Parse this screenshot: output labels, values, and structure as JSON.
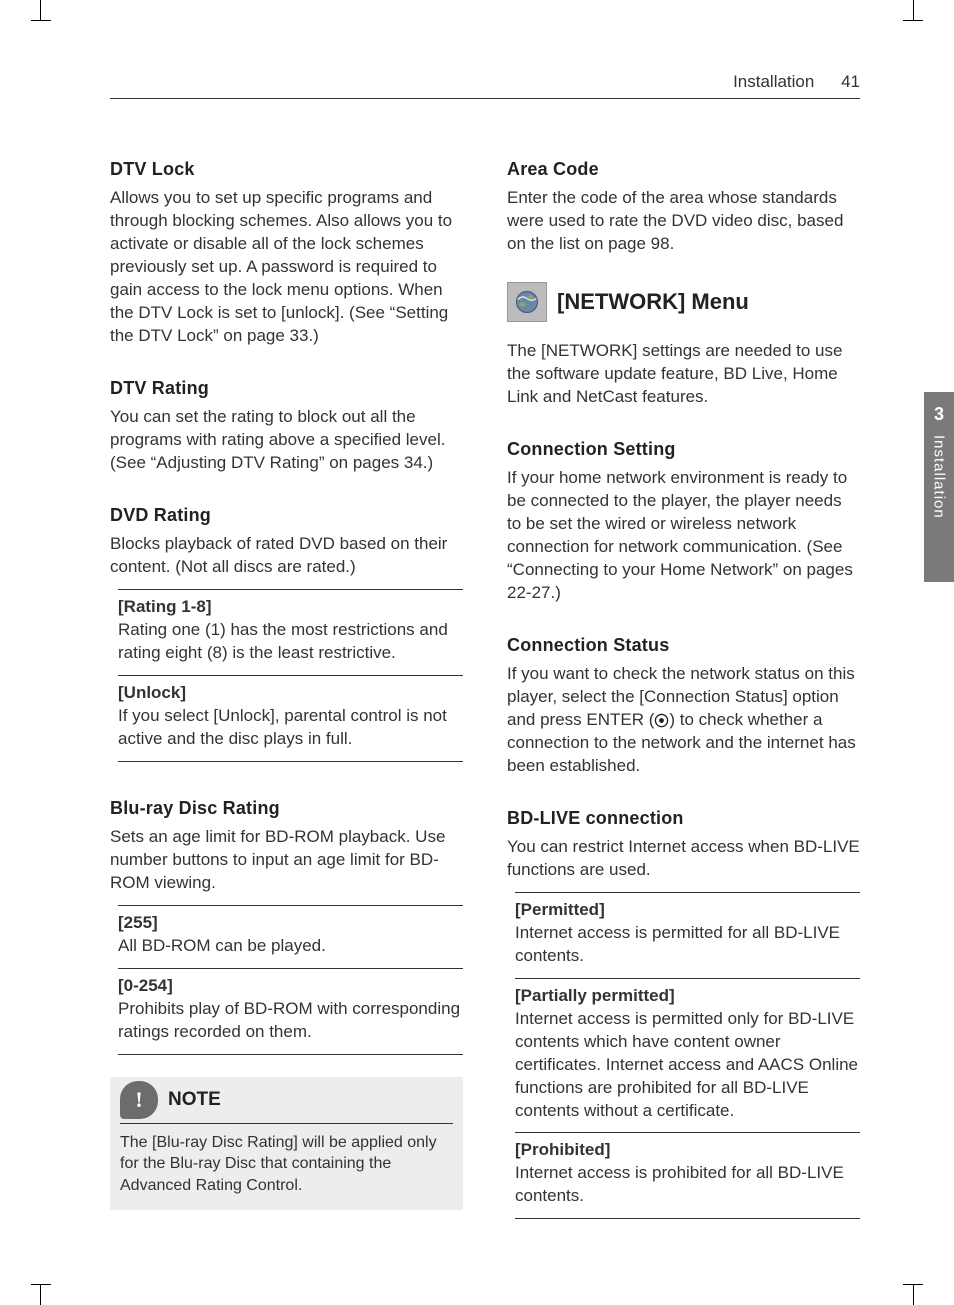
{
  "header": {
    "section": "Installation",
    "page": "41"
  },
  "sideTab": {
    "chapter": "3",
    "label": "Installation"
  },
  "left": {
    "dtvLock": {
      "title": "DTV Lock",
      "body": "Allows you to set up specific programs and through blocking schemes. Also allows you to activate or disable all of the lock schemes previously set up. A password is required to gain access to the lock menu options. When the DTV Lock is set to [unlock]. (See “Setting the DTV Lock” on page 33.)"
    },
    "dtvRating": {
      "title": "DTV Rating",
      "body": "You can set the rating to block out all the programs with rating above a specified level. (See “Adjusting DTV Rating” on pages 34.)"
    },
    "dvdRating": {
      "title": "DVD Rating",
      "body": "Blocks playback of rated DVD based on their content. (Not all discs are rated.)",
      "defs": [
        {
          "dt": "[Rating 1-8]",
          "dd": "Rating one (1) has the most restrictions and rating eight (8) is the least restrictive."
        },
        {
          "dt": "[Unlock]",
          "dd": "If you select [Unlock], parental control is not active and the disc plays in full."
        }
      ]
    },
    "bdRating": {
      "title": "Blu-ray Disc Rating",
      "body": "Sets an age limit for BD-ROM playback. Use number buttons to input an age limit for BD-ROM viewing.",
      "defs": [
        {
          "dt": "[255]",
          "dd": "All BD-ROM can be played."
        },
        {
          "dt": "[0-254]",
          "dd": "Prohibits play of BD-ROM with corresponding ratings recorded on them."
        }
      ]
    },
    "note": {
      "label": "NOTE",
      "body": "The [Blu-ray Disc Rating] will be applied only for the Blu-ray Disc that containing the Advanced Rating Control."
    }
  },
  "right": {
    "areaCode": {
      "title": "Area Code",
      "body": "Enter the code of the area whose standards were used to rate the DVD video disc, based on the list on page 98."
    },
    "networkMenu": {
      "title": "[NETWORK] Menu",
      "body": "The [NETWORK] settings are needed to use the software update feature, BD Live, Home Link and NetCast features."
    },
    "connSetting": {
      "title": "Connection Setting",
      "body": "If your home network environment is ready to be connected to the player, the player needs to be set the wired or wireless network connection for network communication. (See “Connecting to your Home Network” on pages 22-27.)"
    },
    "connStatus": {
      "title": "Connection Status",
      "body1": "If you want to check the network status on this player, select the [Connection Status] option and press ENTER (",
      "body2": ") to check whether a connection to the network and the internet has been established."
    },
    "bdlive": {
      "title": "BD-LIVE connection",
      "body": "You can restrict Internet access when BD-LIVE functions are used.",
      "defs": [
        {
          "dt": "[Permitted]",
          "dd": "Internet access is permitted for all BD-LIVE contents."
        },
        {
          "dt": "[Partially permitted]",
          "dd": "Internet access is permitted only for BD-LIVE contents which have content owner certificates. Internet access and AACS Online functions are prohibited for all BD-LIVE contents without a certificate."
        },
        {
          "dt": "[Prohibited]",
          "dd": "Internet access is prohibited for all BD-LIVE contents."
        }
      ]
    }
  }
}
